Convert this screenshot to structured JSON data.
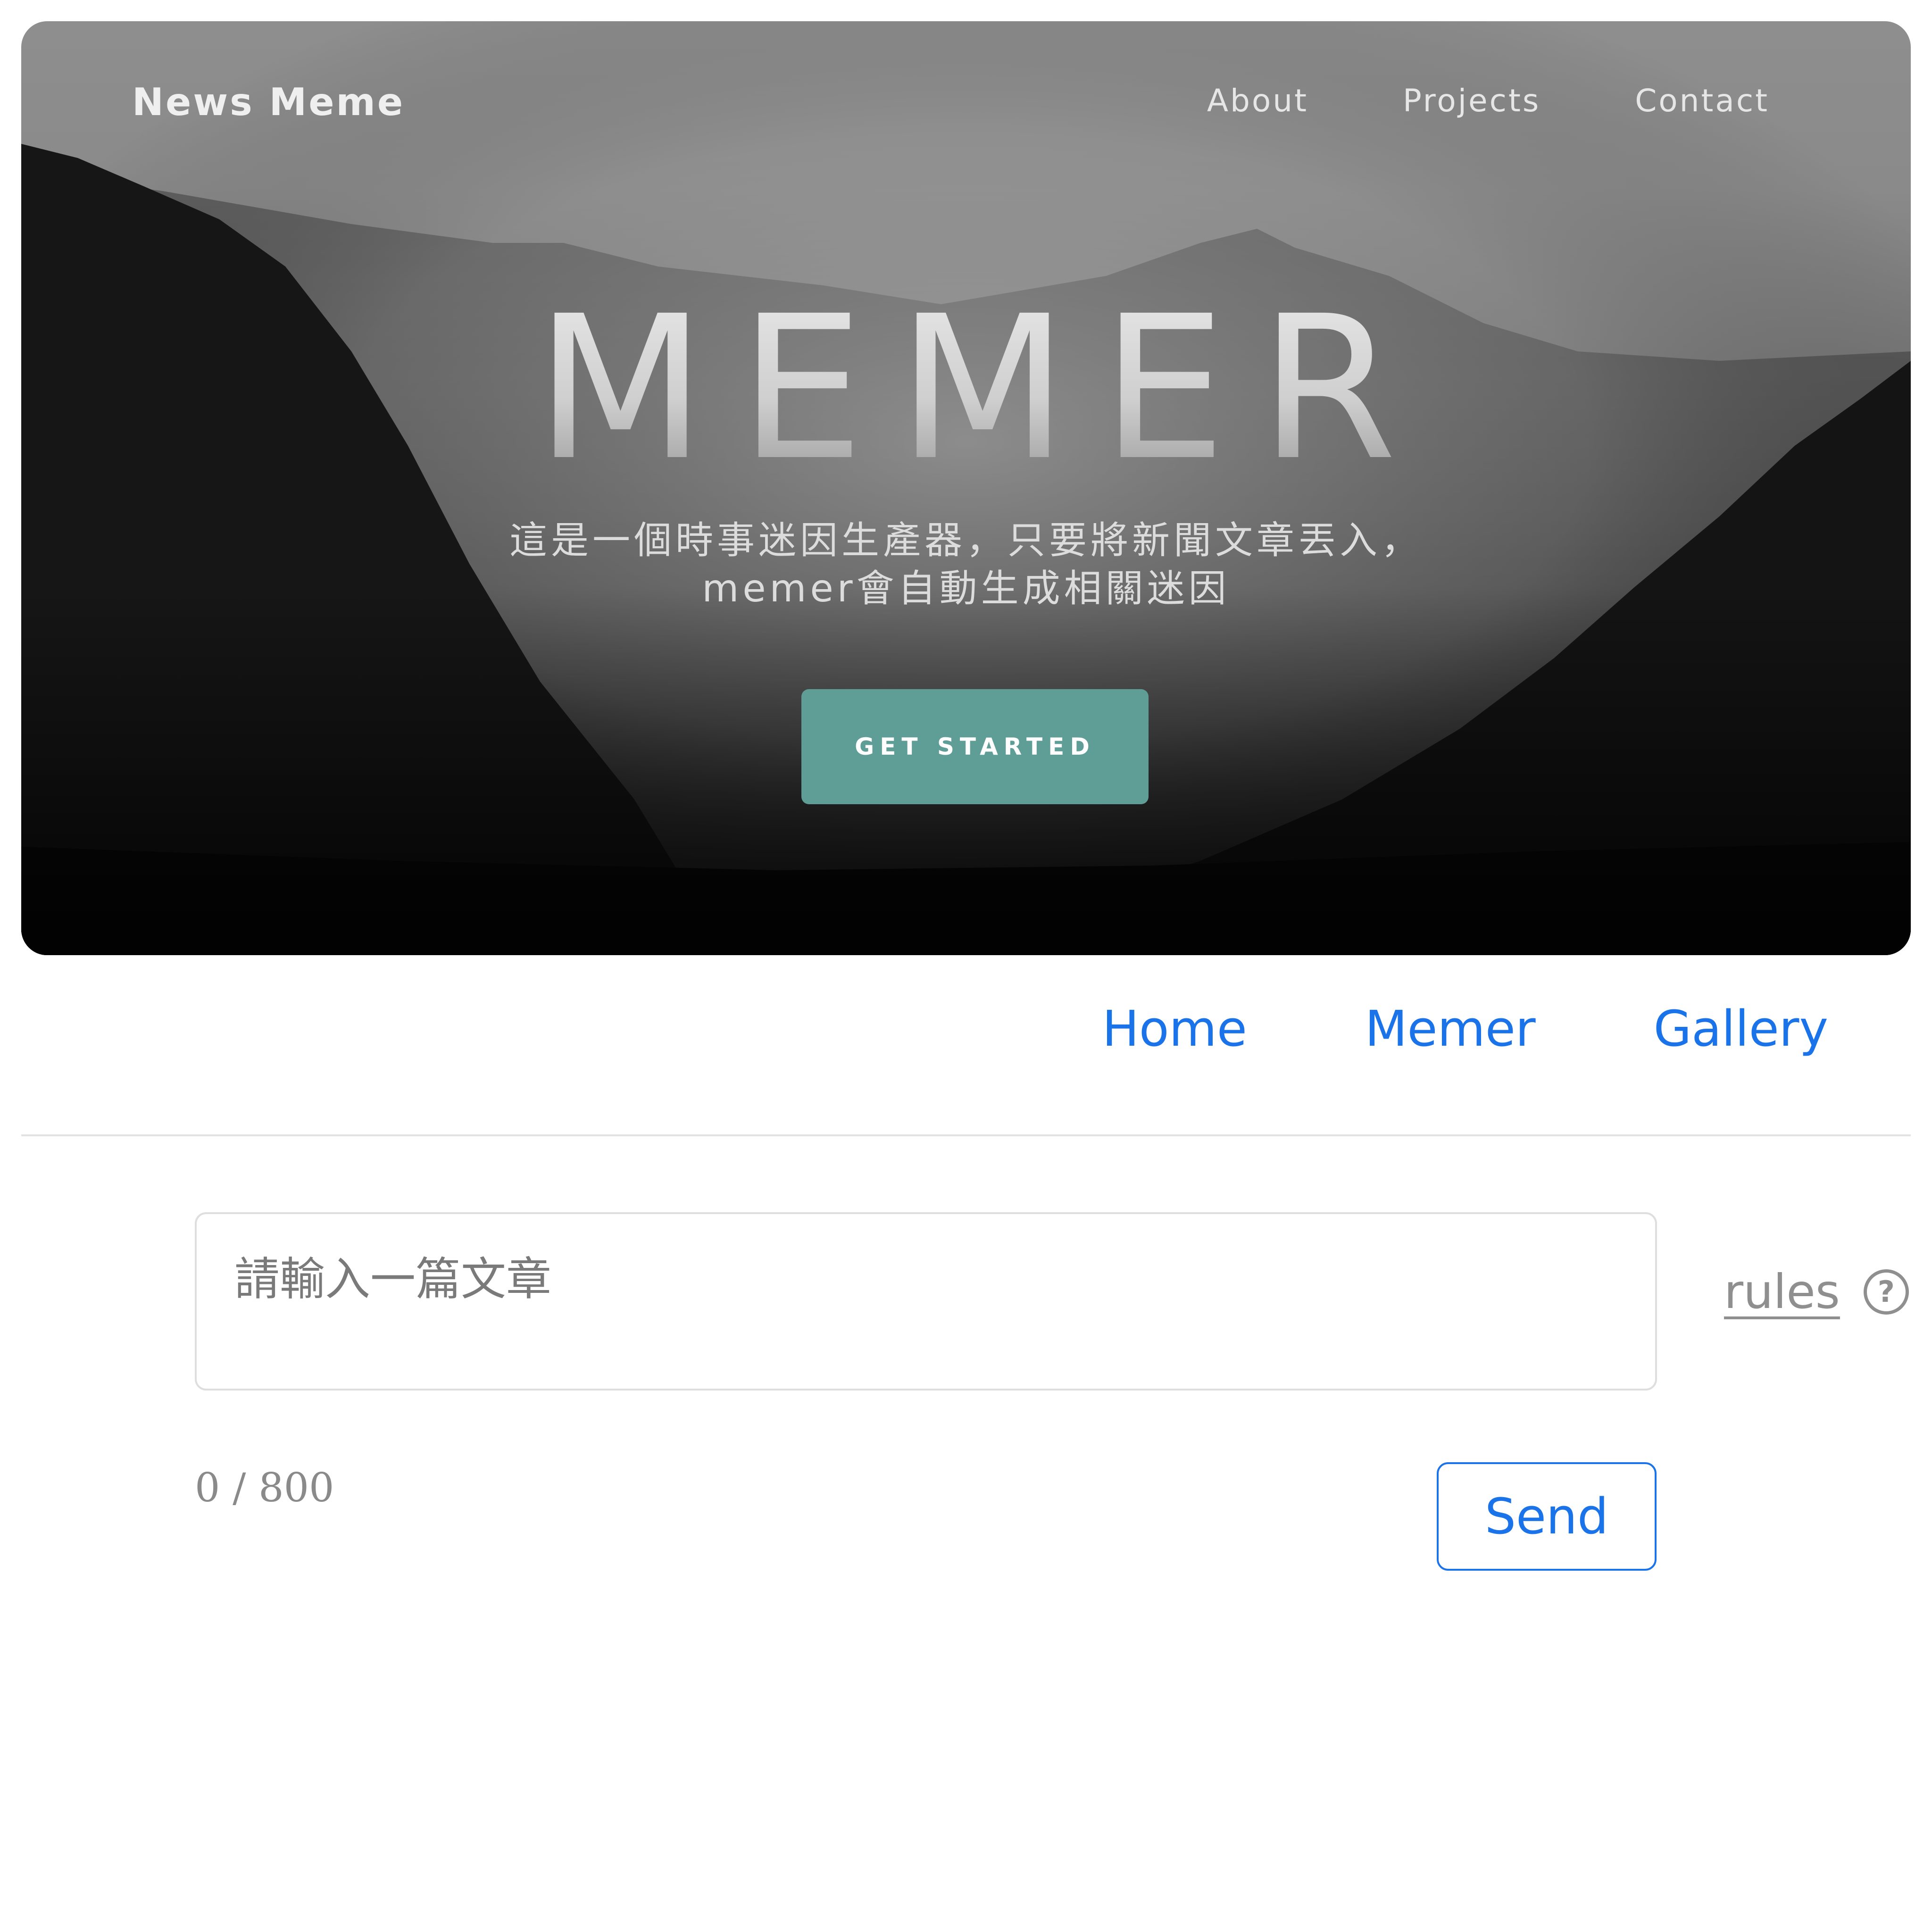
{
  "hero": {
    "brand": "News Meme",
    "nav": [
      {
        "label": "About"
      },
      {
        "label": "Projects"
      },
      {
        "label": "Contact"
      }
    ],
    "title": "MEMER",
    "subtitle_line1": "這是一個時事迷因生產器，只要將新聞文章丟入，",
    "subtitle_line2": "memer會自動生成相關迷因",
    "cta_label": "GET STARTED",
    "cta_color": "#5f9e97"
  },
  "sub_nav": [
    {
      "label": "Home"
    },
    {
      "label": "Memer"
    },
    {
      "label": "Gallery"
    }
  ],
  "form": {
    "placeholder": "請輸入一篇文章",
    "value": "",
    "counter": "0 / 800",
    "rules_label": "rules",
    "help_icon": "question-circle-icon",
    "send_label": "Send"
  },
  "colors": {
    "link_blue": "#1a73e8",
    "muted_gray": "#8f8f8f"
  }
}
